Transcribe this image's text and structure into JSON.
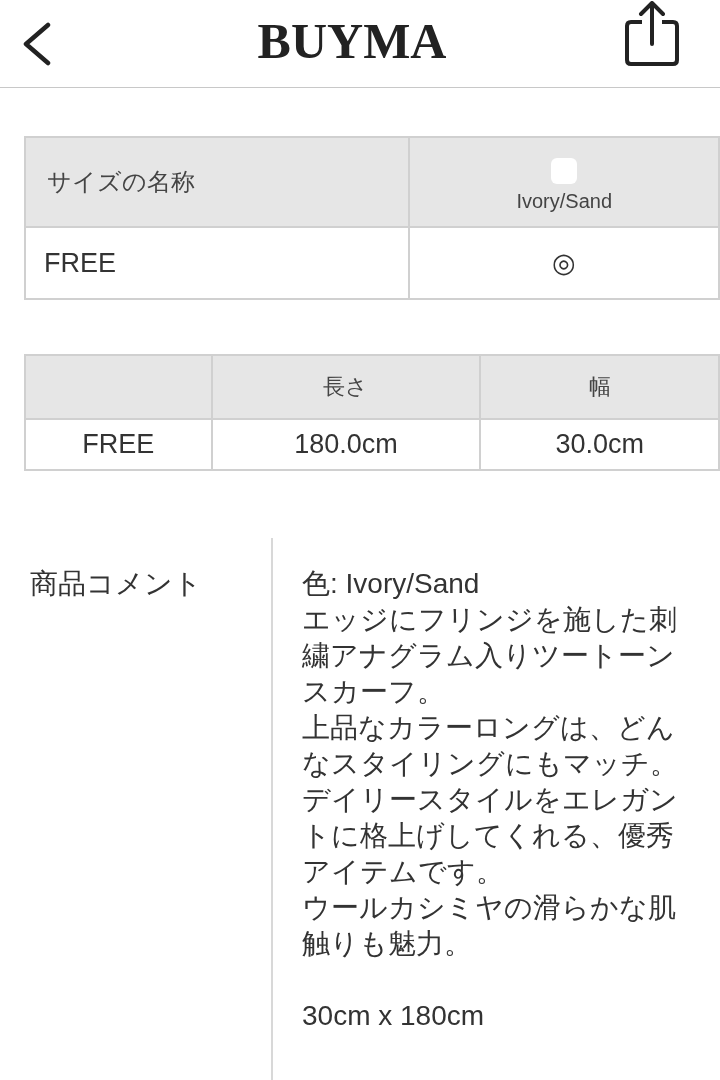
{
  "header": {
    "logo": "BUYMA"
  },
  "size_table": {
    "columns": [
      {
        "label": "サイズの名称"
      },
      {
        "label": "Ivory/Sand",
        "color": "#ffffff"
      }
    ],
    "rows": [
      [
        "FREE",
        "◎"
      ]
    ]
  },
  "measure_table": {
    "columns": [
      "",
      "長さ",
      "幅"
    ],
    "rows": [
      [
        "FREE",
        "180.0cm",
        "30.0cm"
      ]
    ]
  },
  "comment": {
    "label": "商品コメント",
    "groups": [
      [
        "色: Ivory/Sand",
        "エッジにフリンジを施した刺繍アナグラム入りツートーンスカーフ。",
        "上品なカラーロングは、どんなスタイリングにもマッチ。デイリースタイルをエレガントに格上げしてくれる、優秀アイテムです。",
        "ウールカシミヤの滑らかな肌触りも魅力。"
      ],
      [
        "30cm x 180cm"
      ]
    ]
  }
}
